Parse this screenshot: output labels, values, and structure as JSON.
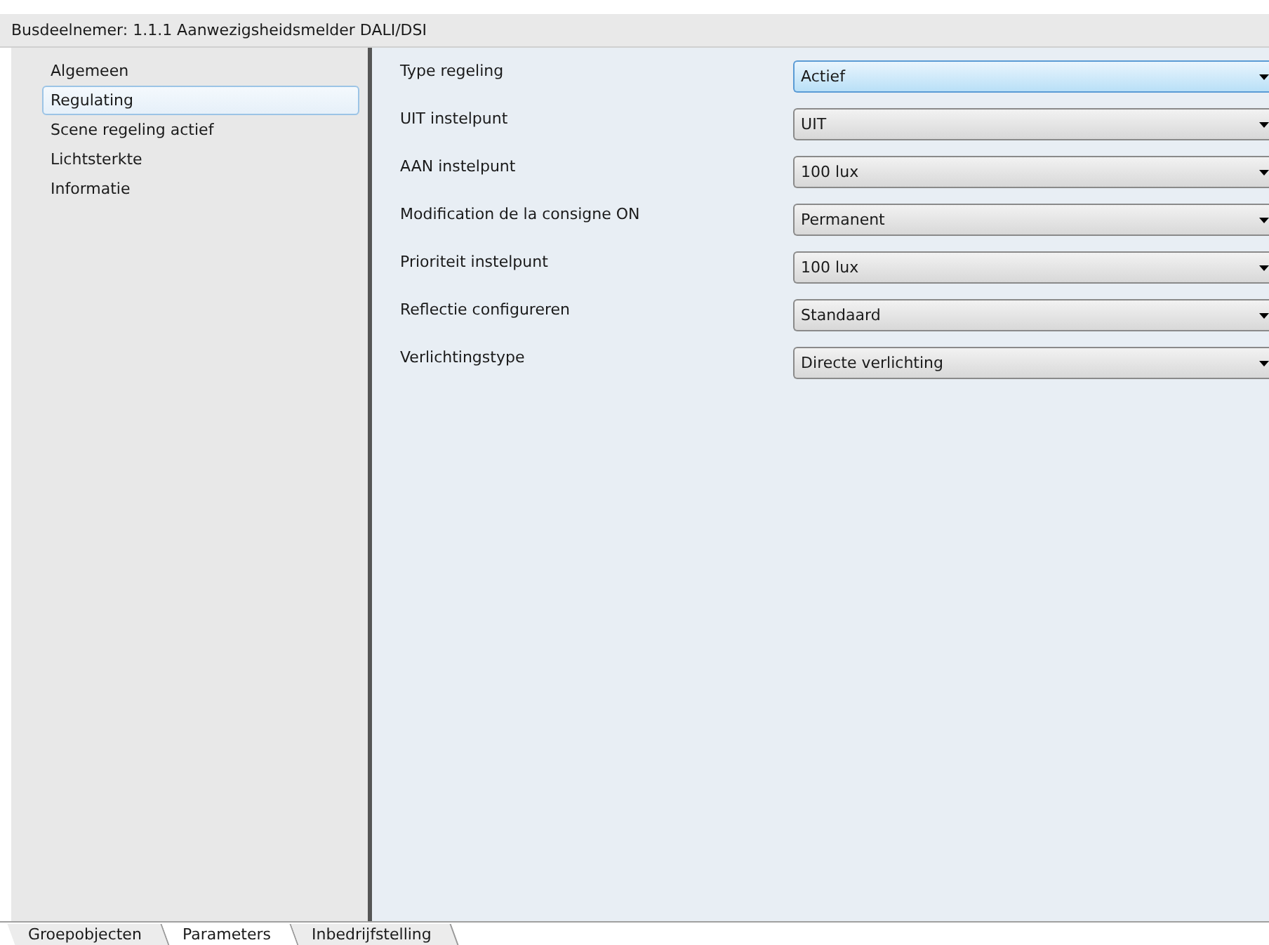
{
  "header": {
    "title": "Busdeelnemer: 1.1.1  Aanwezigsheidsmelder DALI/DSI"
  },
  "sidebar": {
    "items": [
      {
        "label": "Algemeen",
        "selected": false
      },
      {
        "label": "Regulating",
        "selected": true
      },
      {
        "label": "Scene regeling actief",
        "selected": false
      },
      {
        "label": "Lichtsterkte",
        "selected": false
      },
      {
        "label": "Informatie",
        "selected": false
      }
    ]
  },
  "parameters": [
    {
      "label": "Type regeling",
      "value": "Actief",
      "focused": true
    },
    {
      "label": "UIT instelpunt",
      "value": "UIT",
      "focused": false
    },
    {
      "label": "AAN instelpunt",
      "value": "100 lux",
      "focused": false
    },
    {
      "label": "Modification de la consigne ON",
      "value": "Permanent",
      "focused": false
    },
    {
      "label": "Prioriteit instelpunt",
      "value": "100 lux",
      "focused": false
    },
    {
      "label": "Reflectie configureren",
      "value": "Standaard",
      "focused": false
    },
    {
      "label": "Verlichtingstype",
      "value": "Directe verlichting",
      "focused": false
    }
  ],
  "tabs": [
    {
      "label": "Groepobjecten",
      "selected": false
    },
    {
      "label": "Parameters",
      "selected": true
    },
    {
      "label": "Inbedrijfstelling",
      "selected": false
    }
  ]
}
